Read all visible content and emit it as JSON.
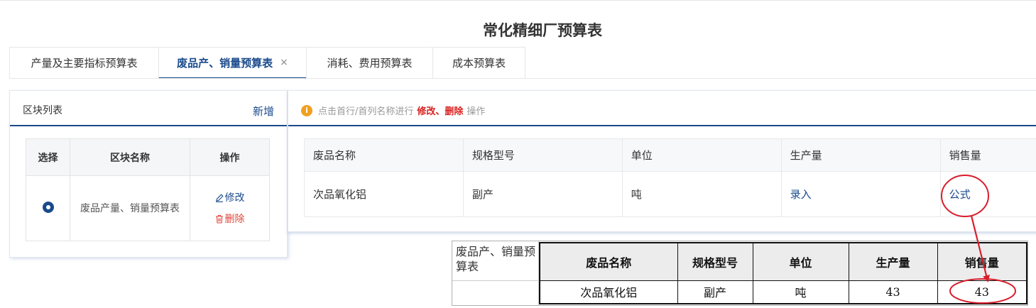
{
  "page": {
    "title": "常化精细厂预算表"
  },
  "tabs": [
    {
      "label": "产量及主要指标预算表",
      "active": false
    },
    {
      "label": "废品产、销量预算表",
      "active": true,
      "close": "×"
    },
    {
      "label": "消耗、费用预算表",
      "active": false
    },
    {
      "label": "成本预算表",
      "active": false
    }
  ],
  "block_list": {
    "title": "区块列表",
    "add_label": "新增",
    "headers": [
      "选择",
      "区块名称",
      "操作"
    ],
    "rows": [
      {
        "selected": true,
        "name": "废品产量、销量预算表",
        "edit_label": "修改",
        "delete_label": "删除"
      }
    ]
  },
  "hint": {
    "prefix": "点击首行/首列名称进行",
    "emphasis": "修改、删除",
    "suffix": "操作"
  },
  "detail_table": {
    "headers": [
      "废品名称",
      "规格型号",
      "单位",
      "生产量",
      "销售量"
    ],
    "rows": [
      {
        "name": "次品氧化铝",
        "spec": "副产",
        "unit": "吨",
        "production": "录入",
        "sales": "公式"
      }
    ]
  },
  "excel_preview": {
    "label": "废品产、销量预算表",
    "headers": [
      "废品名称",
      "规格型号",
      "单位",
      "生产量",
      "销售量"
    ],
    "rows": [
      {
        "name": "次品氧化铝",
        "spec": "副产",
        "unit": "吨",
        "production": "43",
        "sales": "43"
      }
    ]
  },
  "icons": {
    "info": "info-icon",
    "edit": "pencil-icon",
    "delete": "trash-icon"
  },
  "colors": {
    "accent": "#1a4a8c",
    "danger": "#e0453a",
    "warning": "#f0a020",
    "annotation": "#d81e2c"
  }
}
